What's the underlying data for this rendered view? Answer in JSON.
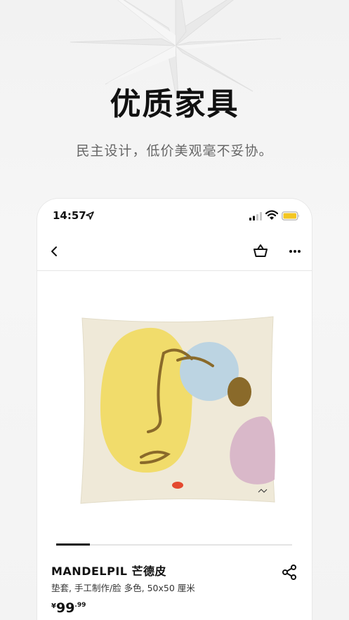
{
  "promo": {
    "headline": "优质家具",
    "subhead": "民主设计，低价美观毫不妥协。"
  },
  "status_bar": {
    "time": "14:57",
    "icons": [
      "location-arrow-icon",
      "signal-icon",
      "wifi-icon",
      "battery-icon"
    ],
    "battery_color": "#f3c623"
  },
  "nav": {
    "icons": [
      "back-icon",
      "shopping-bag-icon",
      "more-icon"
    ]
  },
  "carousel": {
    "active_index": 0
  },
  "product": {
    "name": "MANDELPIL 芒德皮",
    "description": "垫套, 手工制作/脸 多色, 50x50 厘米",
    "price_currency": "¥",
    "price_integer": "99",
    "price_decimal": ".99"
  },
  "colors": {
    "pillow_bg": "#efe9d8",
    "face_yellow": "#f1dc6b",
    "circle_blue": "#bcd4e2",
    "dot_olive": "#8a6a2a",
    "blob_pink": "#d9b8c9",
    "accent_red": "#e4492f"
  }
}
